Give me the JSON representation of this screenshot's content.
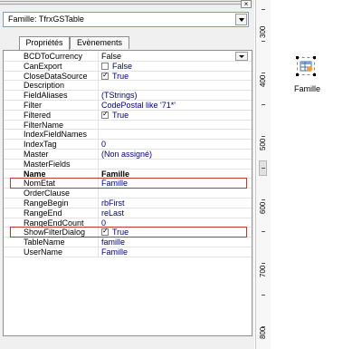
{
  "header": {
    "close_glyph": "×"
  },
  "component_select": {
    "value": "Famille: TfrxGSTable"
  },
  "tabs": [
    {
      "label": "Propriétés"
    },
    {
      "label": "Evènements"
    }
  ],
  "properties": [
    {
      "name": "BCDToCurrency",
      "value": "False",
      "dropdown": true
    },
    {
      "name": "CanExport",
      "value": "False",
      "checkbox": false
    },
    {
      "name": "CloseDataSource",
      "value": "True",
      "checkbox": true
    },
    {
      "name": "Description",
      "value": ""
    },
    {
      "name": "FieldAliases",
      "value": "(TStrings)",
      "link": true
    },
    {
      "name": "Filter",
      "value": "CodePostal like '71*'",
      "link": true
    },
    {
      "name": "Filtered",
      "value": "True",
      "checkbox": true
    },
    {
      "name": "FilterName",
      "value": ""
    },
    {
      "name": "IndexFieldNames",
      "value": ""
    },
    {
      "name": "IndexTag",
      "value": "0",
      "link": true
    },
    {
      "name": "Master",
      "value": "(Non assigné)",
      "link": true
    },
    {
      "name": "MasterFields",
      "value": ""
    },
    {
      "name": "Name",
      "value": "Famille",
      "bold": true
    },
    {
      "name": "NomEtat",
      "value": "Famille",
      "link": true,
      "highlight": true
    },
    {
      "name": "OrderClause",
      "value": ""
    },
    {
      "name": "RangeBegin",
      "value": "rbFirst",
      "link": true
    },
    {
      "name": "RangeEnd",
      "value": "reLast",
      "link": true
    },
    {
      "name": "RangeEndCount",
      "value": "0",
      "link": true
    },
    {
      "name": "ShowFilterDialog",
      "value": "True",
      "checkbox": true,
      "highlight": true
    },
    {
      "name": "TableName",
      "value": "famille",
      "link": true
    },
    {
      "name": "UserName",
      "value": "Famille",
      "link": true
    }
  ],
  "ruler": {
    "labels": [
      "300",
      "400",
      "500",
      "600",
      "700",
      "800"
    ]
  },
  "canvas": {
    "component_label": "Famille",
    "component_icon": "table-component-icon"
  }
}
